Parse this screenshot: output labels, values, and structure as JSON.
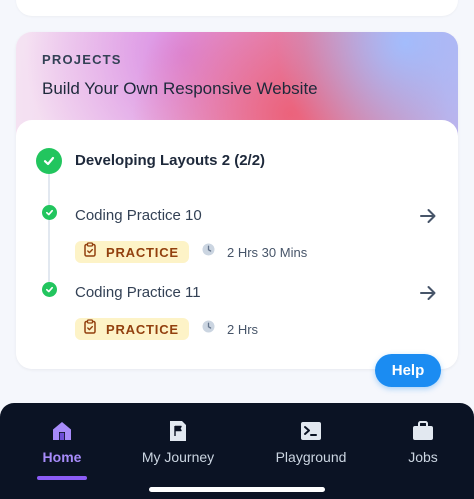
{
  "project": {
    "section_label": "PROJECTS",
    "title": "Build Your Own Responsive Website"
  },
  "module": {
    "title": "Developing Layouts 2 (2/2)",
    "status": "completed"
  },
  "items": [
    {
      "title": "Coding Practice 10",
      "badge": "PRACTICE",
      "duration": "2 Hrs 30 Mins",
      "status": "completed"
    },
    {
      "title": "Coding Practice 11",
      "badge": "PRACTICE",
      "duration": "2 Hrs",
      "status": "completed"
    }
  ],
  "help": {
    "label": "Help"
  },
  "nav": {
    "items": [
      {
        "label": "Home",
        "icon": "home-icon",
        "active": true
      },
      {
        "label": "My Journey",
        "icon": "journey-flag-icon",
        "active": false
      },
      {
        "label": "Playground",
        "icon": "terminal-icon",
        "active": false
      },
      {
        "label": "Jobs",
        "icon": "briefcase-icon",
        "active": false
      }
    ]
  },
  "colors": {
    "accent": "#8b5cf6",
    "success": "#22c55e",
    "help_button": "#1b8cf2",
    "badge_bg": "#fdf3c7",
    "badge_text": "#92400e",
    "nav_bg": "#0b1324"
  }
}
